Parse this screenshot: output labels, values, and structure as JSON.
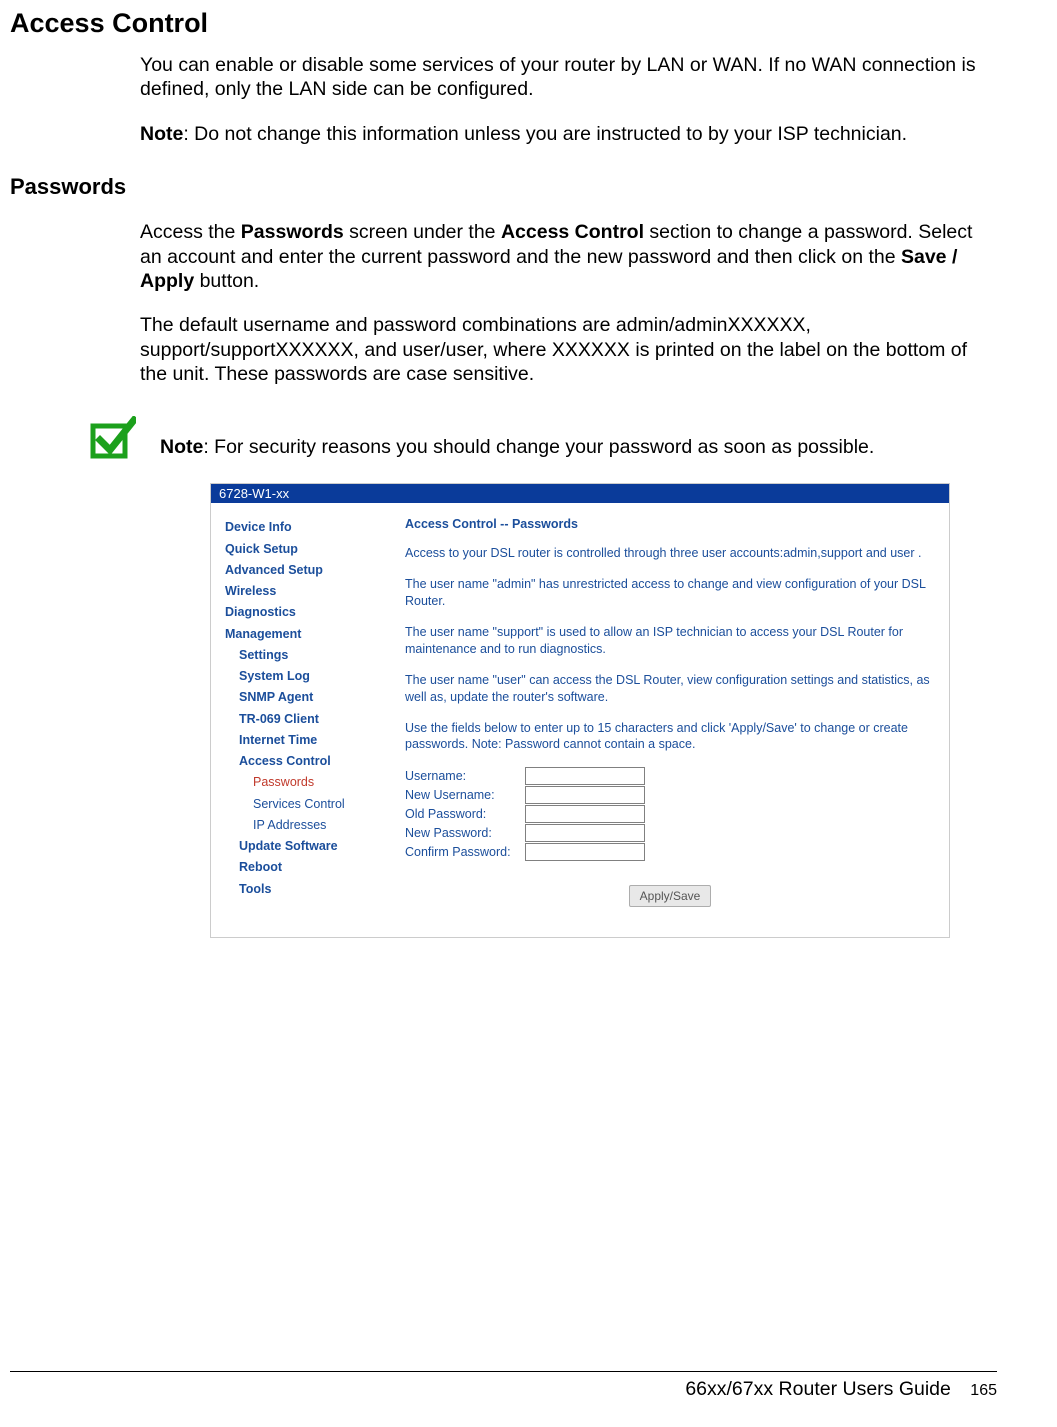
{
  "doc": {
    "h1": "Access Control",
    "intro": "You can enable or disable some services of your router by LAN or WAN. If no WAN connection is defined, only the LAN side can be configured.",
    "note_label": "Note",
    "note_text": ": Do not change this information unless you are instructed to by your ISP technician.",
    "h2": "Passwords",
    "p1_a": "Access the ",
    "p1_b": "Passwords",
    "p1_c": " screen under the ",
    "p1_d": "Access Control",
    "p1_e": " section to change a password. Select an account and enter the current password and the new password and then click on the ",
    "p1_f": "Save / Apply",
    "p1_g": " button.",
    "p2": "The default username and password combinations are admin/adminXXXXXX, support/supportXXXXXX, and user/user, where XXXXXX is printed on the label on the bottom of the unit. These passwords are case sensitive.",
    "callout_note_label": "Note",
    "callout_note_text": ": For security reasons you should change your password as soon as possible."
  },
  "ss": {
    "device_model": "6728-W1-xx",
    "sidebar": {
      "device_info": "Device Info",
      "quick_setup": "Quick Setup",
      "advanced_setup": "Advanced Setup",
      "wireless": "Wireless",
      "diagnostics": "Diagnostics",
      "management": "Management",
      "settings": "Settings",
      "system_log": "System Log",
      "snmp_agent": "SNMP Agent",
      "tr069_client": "TR-069 Client",
      "internet_time": "Internet Time",
      "access_control": "Access Control",
      "passwords": "Passwords",
      "services_control": "Services Control",
      "ip_addresses": "IP Addresses",
      "update_software": "Update Software",
      "reboot": "Reboot",
      "tools": "Tools"
    },
    "main": {
      "title": "Access Control -- Passwords",
      "p1": "Access to your DSL router is controlled through three user accounts:admin,support and user .",
      "p2": "The user name \"admin\" has unrestricted access to change and view configuration of your DSL Router.",
      "p3": "The user name \"support\" is used to allow an ISP technician to access your DSL Router for maintenance and to run diagnostics.",
      "p4": "The user name \"user\" can access the DSL Router, view configuration settings and statistics, as well as, update the router's software.",
      "p5": "Use the fields below to enter up to 15 characters and click 'Apply/Save' to change or create passwords. Note: Password cannot contain a space.",
      "form": {
        "username": "Username:",
        "new_username": "New Username:",
        "old_password": "Old Password:",
        "new_password": "New Password:",
        "confirm_password": "Confirm Password:"
      },
      "apply_label": "Apply/Save"
    }
  },
  "footer": {
    "guide": "66xx/67xx Router Users Guide",
    "page": "165"
  }
}
